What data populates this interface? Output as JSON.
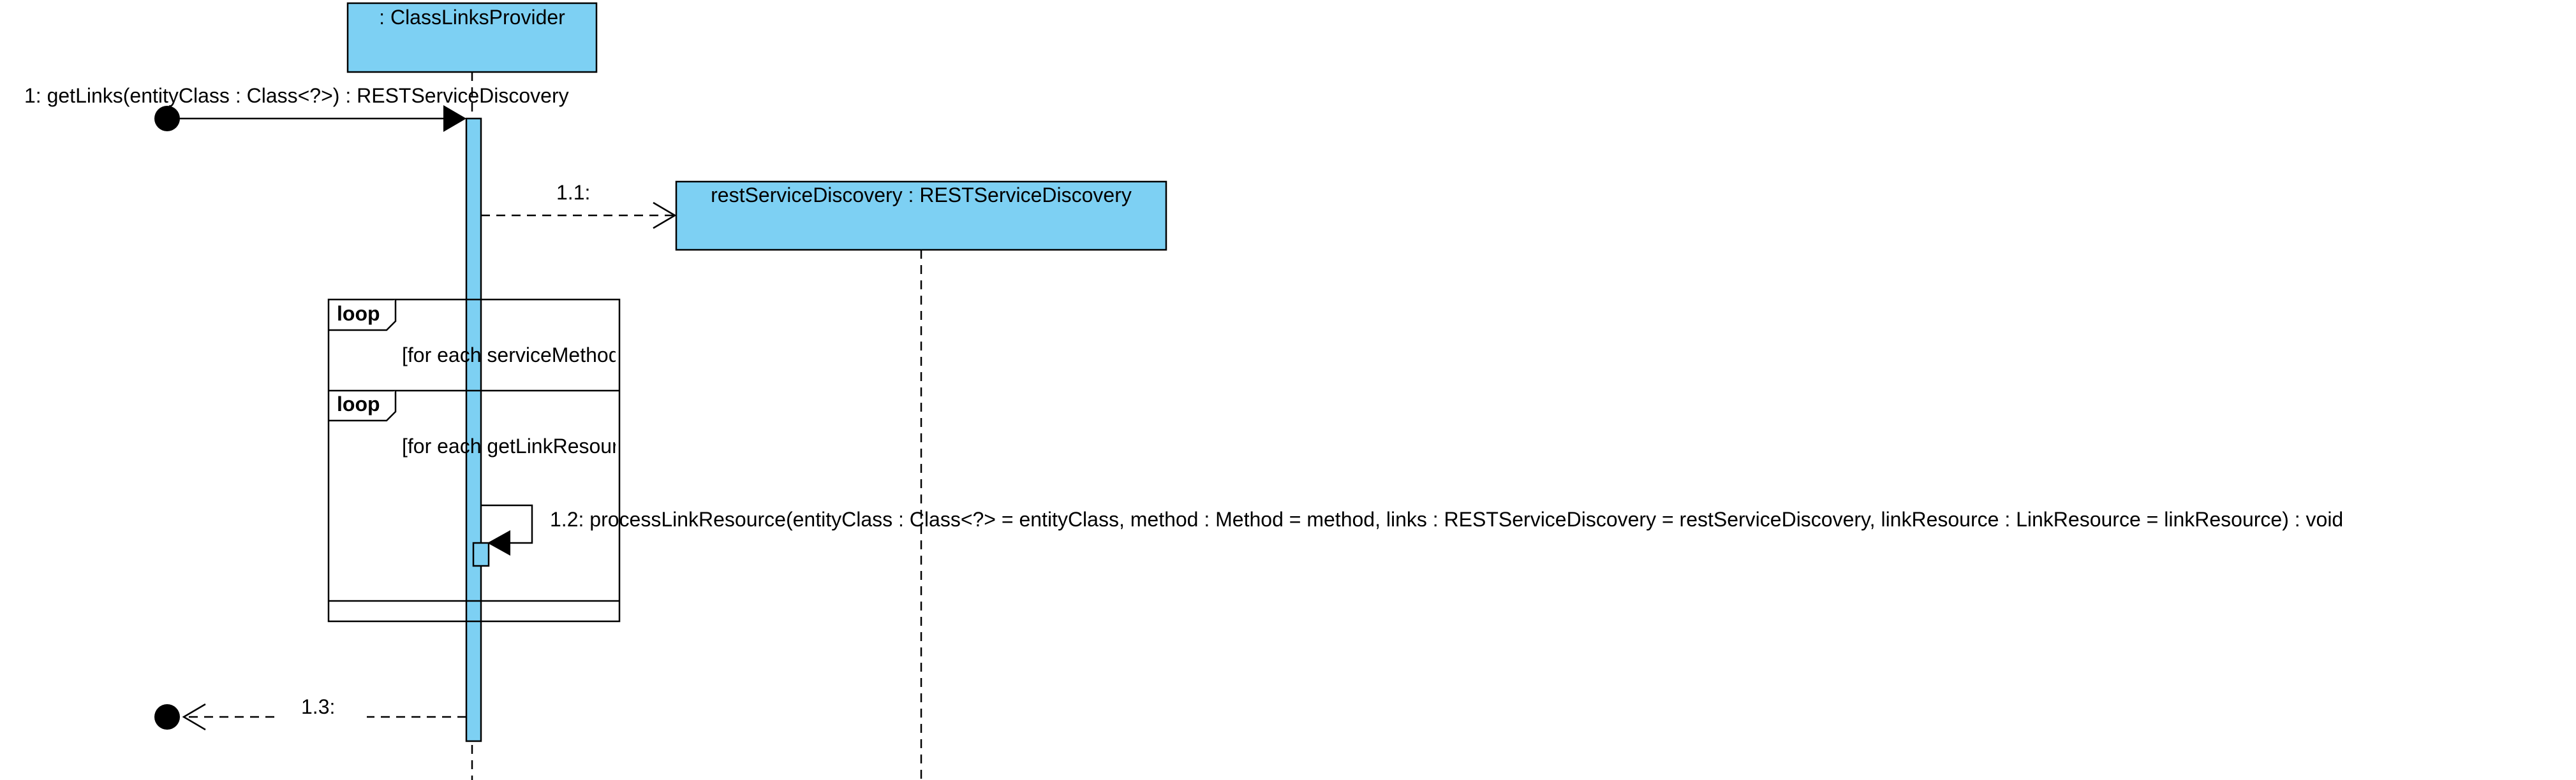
{
  "colors": {
    "box_fill": "#7dd0f3",
    "line": "#000000",
    "background": "#ffffff"
  },
  "lifelines": [
    {
      "id": "provider",
      "label": " : ClassLinksProvider"
    },
    {
      "id": "discovery",
      "label": "restServiceDiscovery : RESTServiceDiscovery"
    }
  ],
  "messages": [
    {
      "id": "m1",
      "label": "1: getLinks(entityClass : Class<?>) : RESTServiceDiscovery",
      "kind": "found-sync"
    },
    {
      "id": "m11",
      "label": "1.1:",
      "kind": "create"
    },
    {
      "id": "m12",
      "label": "1.2: processLinkResource(entityClass : Class<?> = entityClass, method : Method = method, links : RESTServiceDiscovery = restServiceDiscovery, linkResource : LinkResource = linkResource) : void",
      "kind": "self"
    },
    {
      "id": "m13",
      "label": "1.3:",
      "kind": "lost-reply"
    }
  ],
  "fragments": [
    {
      "id": "outer",
      "operator": "loop",
      "guard": "[for each serviceMethod]"
    },
    {
      "id": "inner",
      "operator": "loop",
      "guard": "[for each getLinkResource]"
    }
  ]
}
